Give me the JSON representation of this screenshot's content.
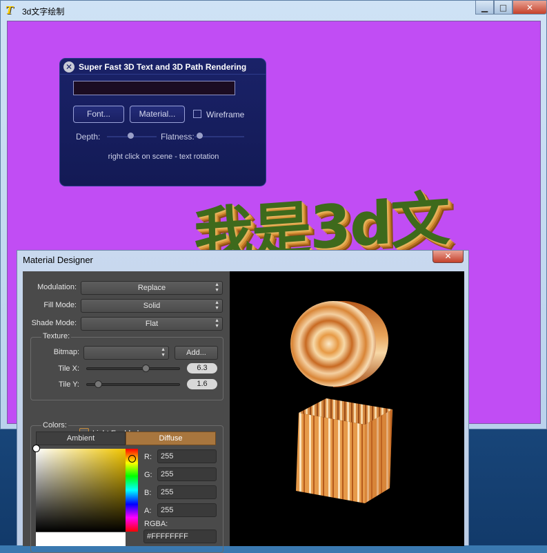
{
  "window": {
    "title": "3d文字绘制",
    "minimize": "▁",
    "maximize": "□",
    "close": "✕",
    "background_color": "#c14df4"
  },
  "scene": {
    "rendered_text": "我是3d文"
  },
  "panel": {
    "title": "Super Fast 3D Text and 3D Path Rendering",
    "close_glyph": "✕",
    "text_value": "",
    "font_button": "Font...",
    "material_button": "Material...",
    "wireframe_label": "Wireframe",
    "wireframe_checked": false,
    "depth_label": "Depth:",
    "flatness_label": "Flatness:",
    "hint": "right click on scene - text rotation"
  },
  "material_designer": {
    "title": "Material Designer",
    "close_glyph": "✕",
    "modulation_label": "Modulation:",
    "modulation_value": "Replace",
    "fill_mode_label": "Fill Mode:",
    "fill_mode_value": "Solid",
    "shade_mode_label": "Shade Mode:",
    "shade_mode_value": "Flat",
    "texture_group": "Texture:",
    "bitmap_label": "Bitmap:",
    "bitmap_value": "",
    "add_button": "Add...",
    "tile_x_label": "Tile X:",
    "tile_x_value": "6.3",
    "tile_y_label": "Tile Y:",
    "tile_y_value": "1.6",
    "light_enabled_label": "Light Enabled",
    "colors_group": "Colors:",
    "tabs": [
      "Ambient",
      "Diffuse"
    ],
    "active_tab": "Diffuse",
    "channels": [
      {
        "label": "R:",
        "value": "255"
      },
      {
        "label": "G:",
        "value": "255"
      },
      {
        "label": "B:",
        "value": "255"
      },
      {
        "label": "A:",
        "value": "255"
      }
    ],
    "rgba_label": "RGBA:",
    "rgba_value": "#FFFFFFFF",
    "accent_color": "#a8763e"
  }
}
